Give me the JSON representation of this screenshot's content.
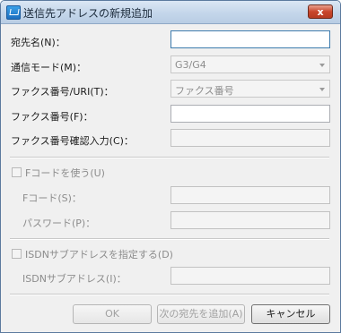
{
  "window": {
    "title": "送信先アドレスの新規追加",
    "close_glyph": "x"
  },
  "form": {
    "name_label": "宛先名(N)：",
    "name_value": "",
    "mode_label": "通信モード(M)：",
    "mode_value": "G3/G4",
    "faxuri_label": "ファクス番号/URI(T)：",
    "faxuri_value": "ファクス番号",
    "fax_label": "ファクス番号(F)：",
    "fax_value": "",
    "fax_confirm_label": "ファクス番号確認入力(C)：",
    "fax_confirm_value": ""
  },
  "fcode": {
    "checkbox_label": "Fコードを使う(U)",
    "checked": false,
    "code_label": "Fコード(S)：",
    "code_value": "",
    "password_label": "パスワード(P)：",
    "password_value": ""
  },
  "isdn": {
    "checkbox_label": "ISDNサブアドレスを指定する(D)",
    "checked": false,
    "subaddress_label": "ISDNサブアドレス(I)：",
    "subaddress_value": ""
  },
  "buttons": {
    "ok": "OK",
    "add_next": "次の宛先を追加(A)",
    "cancel": "キャンセル"
  },
  "icons": {
    "app": "address-book-icon",
    "close": "close-icon",
    "dropdown": "chevron-down-icon"
  }
}
